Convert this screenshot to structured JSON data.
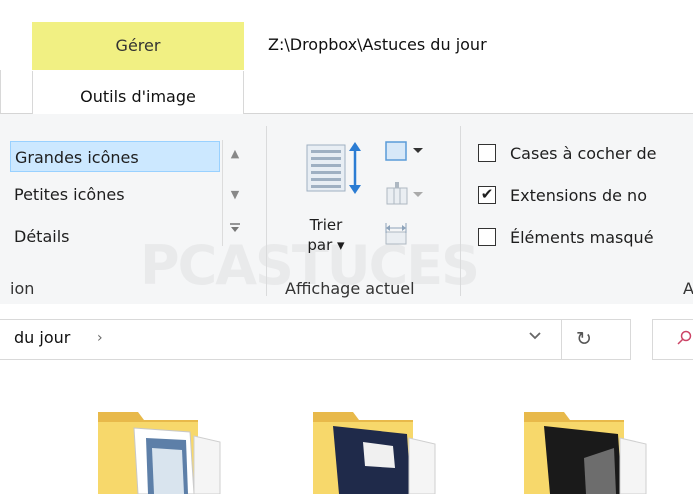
{
  "title_bar": {
    "contextual_tab": "Gérer",
    "path": "Z:\\Dropbox\\Astuces du jour"
  },
  "tabs": {
    "active": "Outils d'image"
  },
  "ribbon": {
    "layout_items": [
      "Grandes icônes",
      "Petites icônes",
      "Détails"
    ],
    "layout_group_label": "ion",
    "sort_button_line1": "Trier",
    "sort_button_line2": "par ▾",
    "current_view_group_label": "Affichage actuel",
    "checkboxes": [
      {
        "label": "Cases à cocher de",
        "checked": false
      },
      {
        "label": "Extensions de no",
        "checked": true
      },
      {
        "label": "Éléments masqué",
        "checked": false
      }
    ],
    "show_hide_group_label": "A"
  },
  "address_bar": {
    "text": "du jour",
    "chevron": "›"
  },
  "watermark": "PCASTUCES",
  "colors": {
    "contextual_tab_bg": "#f1f083",
    "selected_item_bg": "#cce8ff",
    "ribbon_bg": "#f5f6f7"
  }
}
